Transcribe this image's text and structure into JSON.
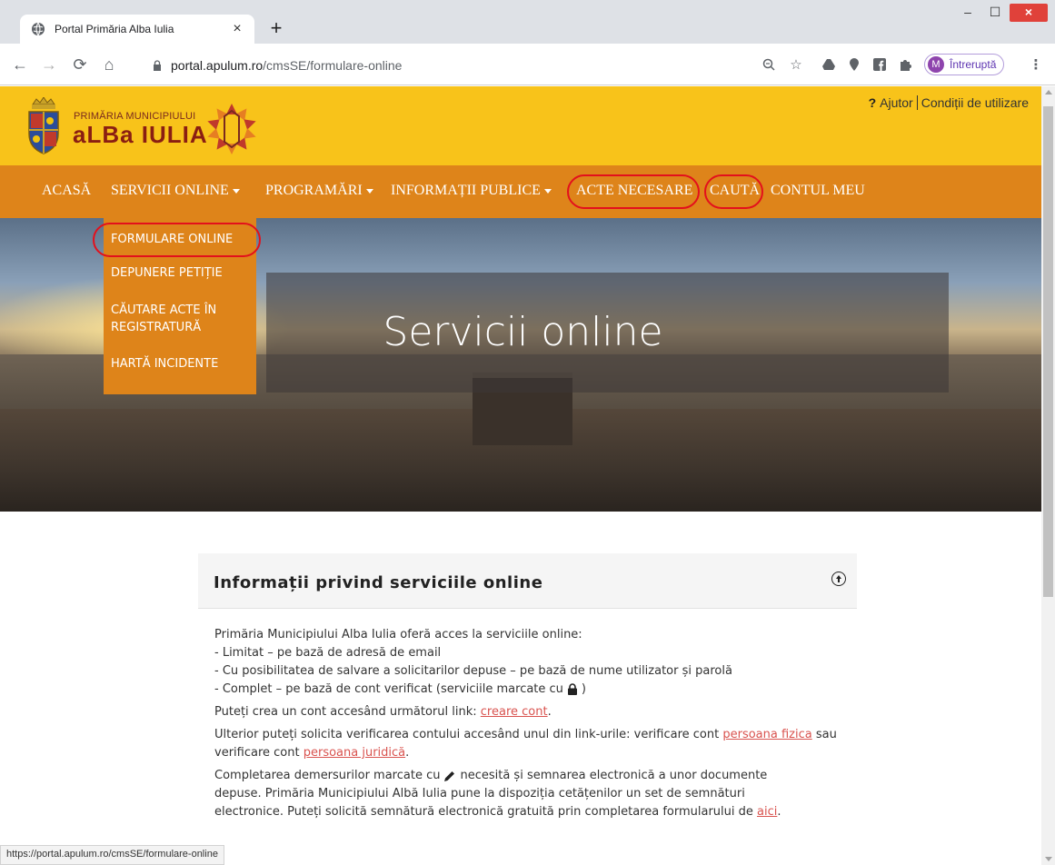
{
  "browser": {
    "tab_title": "Portal Primăria Alba Iulia",
    "url_host": "portal.apulum.ro",
    "url_path": "/cmsSE/formulare-online",
    "profile_initial": "M",
    "profile_label": "Întreruptă",
    "status_url": "https://portal.apulum.ro/cmsSE/formulare-online"
  },
  "header": {
    "logo_line1": "PRIMĂRIA MUNICIPIULUI",
    "logo_line2": "aLBa IULIA",
    "help_label": "Ajutor",
    "terms_label": "Condiții de utilizare"
  },
  "nav": {
    "items": [
      {
        "label": "ACASĂ"
      },
      {
        "label": "SERVICII ONLINE"
      },
      {
        "label": "PROGRAMĂRI"
      },
      {
        "label": "INFORMAȚII PUBLICE"
      },
      {
        "label": "ACTE NECESARE"
      },
      {
        "label": "CAUTĂ"
      },
      {
        "label": "CONTUL MEU"
      }
    ],
    "dropdown": [
      {
        "label": "FORMULARE ONLINE"
      },
      {
        "label": "DEPUNERE PETIȚIE"
      },
      {
        "label": "CĂUTARE ACTE ÎN"
      },
      {
        "label": "REGISTRATURĂ"
      },
      {
        "label": "HARTĂ INCIDENTE"
      }
    ]
  },
  "hero": {
    "title": "Servicii online"
  },
  "panel": {
    "title": "Informații privind serviciile online",
    "intro": "Primăria Municipiului Alba Iulia oferă acces la serviciile online:",
    "bullet1": "- Limitat – pe bază de adresă de email",
    "bullet2": "- Cu posibilitatea de salvare a solicitarilor depuse – pe bază de nume utilizator și parolă",
    "bullet3": "- Complet – pe bază de cont verificat (serviciile marcate cu",
    "bullet3_end": ")",
    "account_text": "Puteți crea un cont accesând următorul link:",
    "account_link": "creare cont",
    "account_end": ".",
    "verify_text": "Ulterior puteți solicita verificarea contului accesând unul din link-urile: verificare cont",
    "verify_link1": "persoana fizica",
    "verify_mid": "sau verificare cont",
    "verify_link2": "persoana juridică",
    "verify_end": ".",
    "sign_text1": "Completarea demersurilor marcate cu",
    "sign_text2": "necesită și semnarea electronică a unor documente",
    "sign_line2": "depuse. Primăria Municipiului Albă Iulia pune la dispoziția cetățenilor un set de semnături",
    "sign_line3": "electronice. Puteți solicită semnătură electronică gratuită prin completarea formularului de",
    "sign_link": "aici",
    "sign_end": "."
  },
  "colors": {
    "header_yellow": "#f8c31a",
    "nav_orange": "#de841a",
    "annotation_red": "#e3101c",
    "link_red": "#d9534f"
  }
}
